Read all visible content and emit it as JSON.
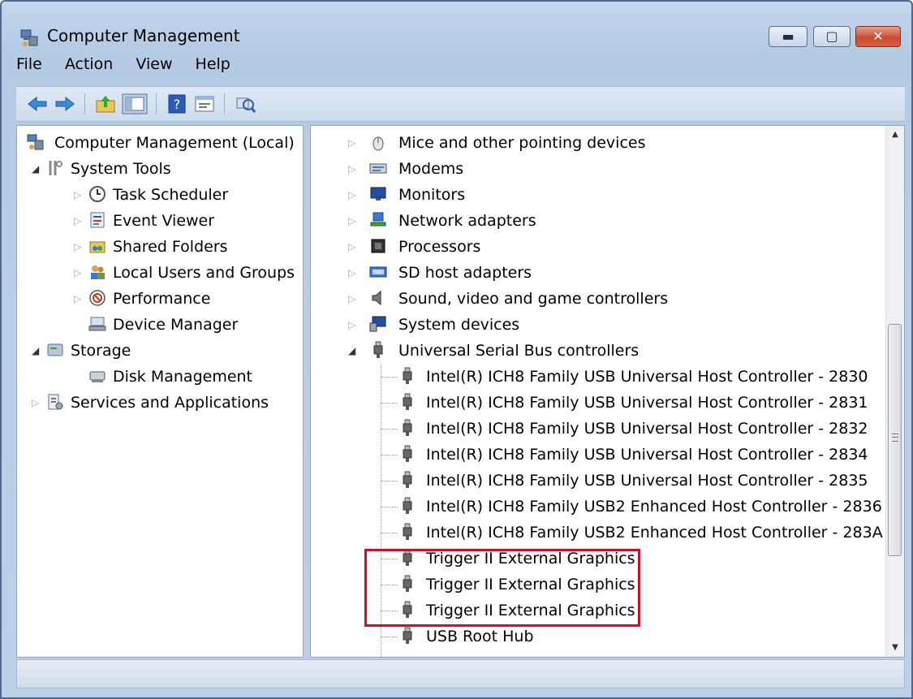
{
  "window": {
    "title": "Computer Management"
  },
  "menu": [
    "File",
    "Action",
    "View",
    "Help"
  ],
  "toolbar": [
    "back-icon",
    "forward-icon",
    "up-folder-icon",
    "show-hide-tree-icon",
    "help-icon",
    "properties-icon",
    "scan-hardware-icon"
  ],
  "tree": {
    "root": "Computer Management (Local)",
    "items": [
      "System Tools",
      "Task Scheduler",
      "Event Viewer",
      "Shared Folders",
      "Local Users and Groups",
      "Performance",
      "Device Manager",
      "Storage",
      "Disk Management",
      "Services and Applications"
    ],
    "selected": "Device Manager"
  },
  "devices": {
    "categories": [
      "Mice and other pointing devices",
      "Modems",
      "Monitors",
      "Network adapters",
      "Processors",
      "SD host adapters",
      "Sound, video and game controllers",
      "System devices",
      "Universal Serial Bus controllers"
    ],
    "usb_children": [
      "Intel(R) ICH8 Family USB Universal Host Controller - 2830",
      "Intel(R) ICH8 Family USB Universal Host Controller - 2831",
      "Intel(R) ICH8 Family USB Universal Host Controller - 2832",
      "Intel(R) ICH8 Family USB Universal Host Controller - 2834",
      "Intel(R) ICH8 Family USB Universal Host Controller - 2835",
      "Intel(R) ICH8 Family USB2 Enhanced Host Controller - 2836",
      "Intel(R) ICH8 Family USB2 Enhanced Host Controller - 283A",
      "Trigger II External Graphics",
      "Trigger II External Graphics",
      "Trigger II External Graphics",
      "USB Root Hub"
    ]
  },
  "colors": {
    "highlight": "#c8112a",
    "chrome": "#bcd0e8"
  }
}
